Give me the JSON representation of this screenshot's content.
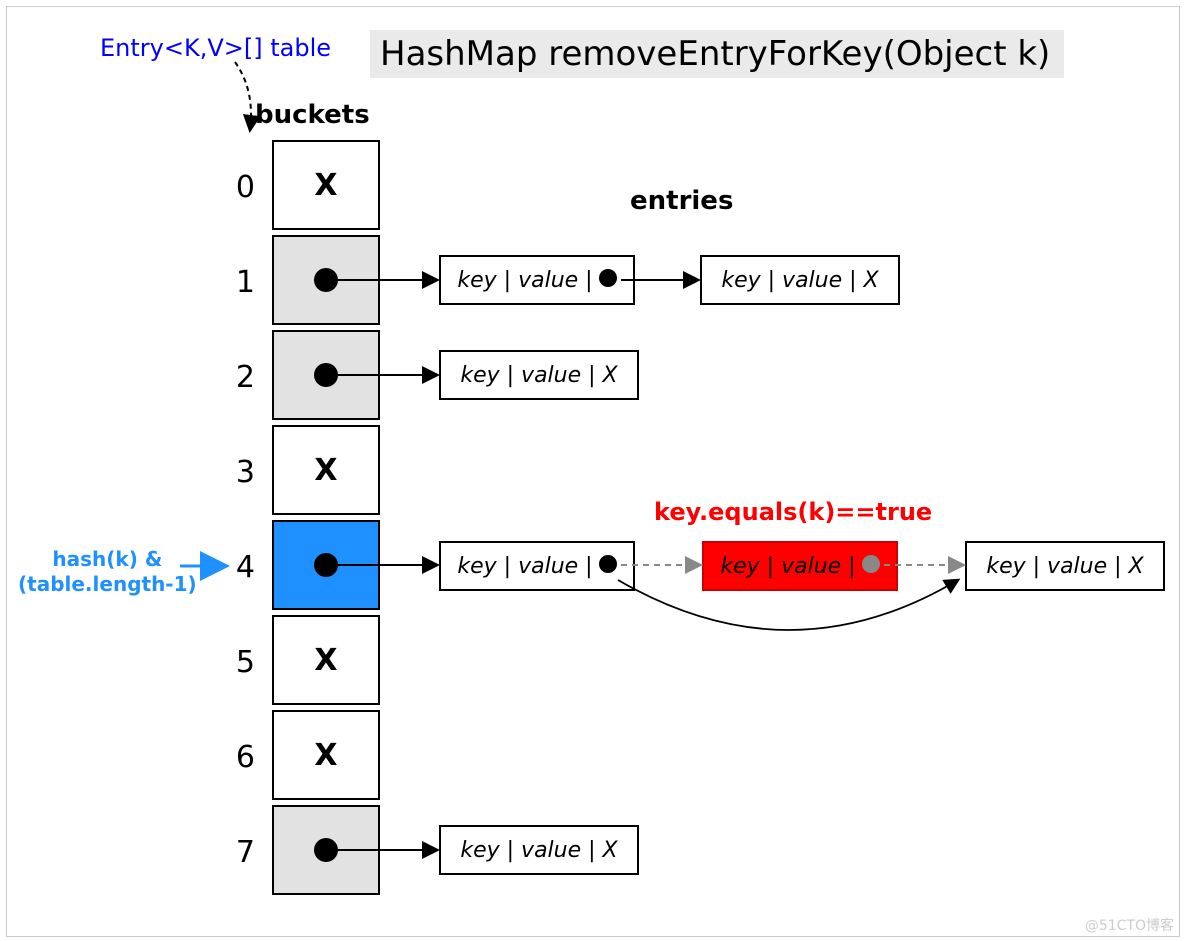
{
  "title": "HashMap removeEntryForKey(Object k)",
  "labels": {
    "table": "Entry<K,V>[] table",
    "buckets": "buckets",
    "entries": "entries",
    "hash_line1": "hash(k) &",
    "hash_line2": "(table.length-1)",
    "equals": "key.equals(k)==true"
  },
  "bucketIndices": [
    "0",
    "1",
    "2",
    "3",
    "4",
    "5",
    "6",
    "7"
  ],
  "entryText": {
    "kv_dot": "key | value | ",
    "kv_x": "key | value |  X"
  },
  "watermark": "@51CTO博客",
  "chart_data": {
    "type": "diagram",
    "structure": "HashMap bucket array with linked-list entries; removal of matched node in bucket 4 via equals(k)",
    "buckets": [
      {
        "index": 0,
        "state": "empty"
      },
      {
        "index": 1,
        "state": "occupied",
        "chain": [
          {
            "next": true
          },
          {
            "next": false
          }
        ]
      },
      {
        "index": 2,
        "state": "occupied",
        "chain": [
          {
            "next": false
          }
        ]
      },
      {
        "index": 3,
        "state": "empty"
      },
      {
        "index": 4,
        "state": "occupied",
        "highlighted": true,
        "chain": [
          {
            "next": true
          },
          {
            "next": true,
            "removed": true,
            "matched_by": "key.equals(k)==true"
          },
          {
            "next": false
          }
        ],
        "bypass_link": {
          "from": 0,
          "to": 2
        }
      },
      {
        "index": 5,
        "state": "empty"
      },
      {
        "index": 6,
        "state": "empty"
      },
      {
        "index": 7,
        "state": "occupied",
        "chain": [
          {
            "next": false
          }
        ]
      }
    ],
    "hash_target_bucket": 4,
    "hash_expression": "hash(k) & (table.length-1)"
  }
}
